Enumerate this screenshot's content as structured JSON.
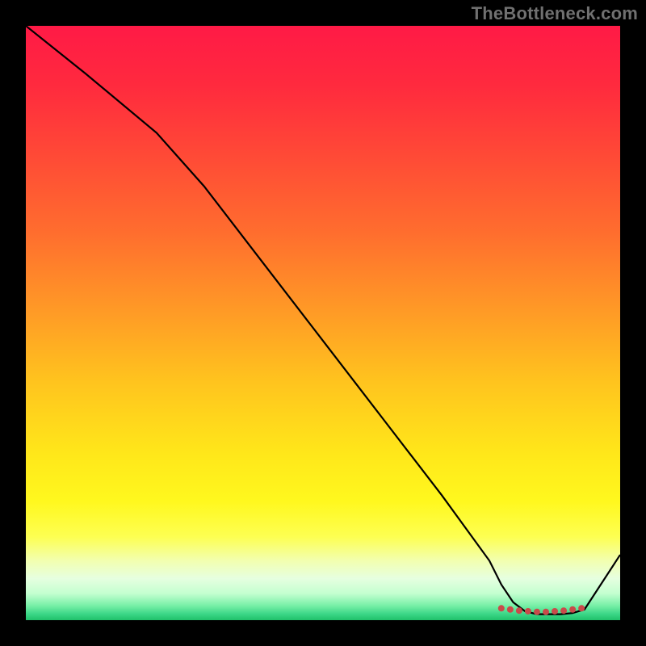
{
  "watermark": "TheBottleneck.com",
  "chart_data": {
    "type": "line",
    "title": "",
    "xlabel": "",
    "ylabel": "",
    "xlim": [
      0,
      100
    ],
    "ylim": [
      0,
      100
    ],
    "series": [
      {
        "name": "curve",
        "x": [
          0,
          10,
          22,
          30,
          40,
          50,
          60,
          70,
          78,
          80,
          82,
          84,
          86,
          88,
          90,
          92,
          94,
          100
        ],
        "y": [
          100,
          92,
          82,
          73,
          60,
          47,
          34,
          21,
          10,
          6,
          3,
          1.5,
          1,
          1,
          1,
          1.2,
          1.8,
          11
        ]
      }
    ],
    "markers": {
      "name": "flat-region-markers",
      "color": "#c94a4a",
      "x": [
        80,
        81.5,
        83,
        84.5,
        86,
        87.5,
        89,
        90.5,
        92,
        93.5
      ],
      "y": [
        2.0,
        1.8,
        1.6,
        1.5,
        1.4,
        1.4,
        1.5,
        1.6,
        1.8,
        2.0
      ],
      "size": 4
    },
    "gradient_stops": [
      {
        "offset": 0.0,
        "color": "#ff1a46"
      },
      {
        "offset": 0.1,
        "color": "#ff2a3e"
      },
      {
        "offset": 0.22,
        "color": "#ff4a36"
      },
      {
        "offset": 0.35,
        "color": "#ff6e2e"
      },
      {
        "offset": 0.48,
        "color": "#ff9a26"
      },
      {
        "offset": 0.6,
        "color": "#ffc41e"
      },
      {
        "offset": 0.72,
        "color": "#ffe71a"
      },
      {
        "offset": 0.8,
        "color": "#fff81e"
      },
      {
        "offset": 0.86,
        "color": "#fdff52"
      },
      {
        "offset": 0.9,
        "color": "#f2ffb0"
      },
      {
        "offset": 0.93,
        "color": "#e6ffe0"
      },
      {
        "offset": 0.955,
        "color": "#c4ffd0"
      },
      {
        "offset": 0.975,
        "color": "#7af0a8"
      },
      {
        "offset": 0.99,
        "color": "#3ad686"
      },
      {
        "offset": 1.0,
        "color": "#20c06a"
      }
    ]
  }
}
